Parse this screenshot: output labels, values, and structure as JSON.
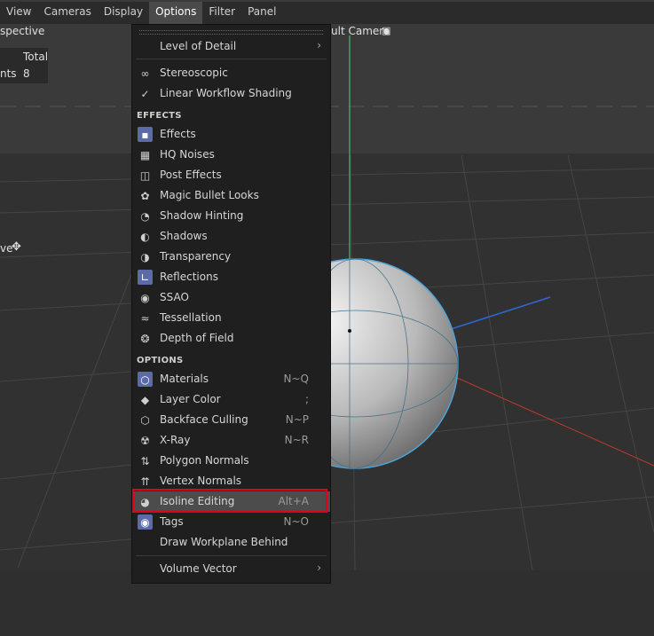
{
  "menubar": {
    "items": [
      "View",
      "Cameras",
      "Display",
      "Options",
      "Filter",
      "Panel"
    ],
    "active": "Options"
  },
  "viewport": {
    "view_name": "spective",
    "camera_label": "ult Camera",
    "hud_header": "Total",
    "hud_row_label": "nts",
    "hud_row_value": "8",
    "move_label": "ve"
  },
  "menu": {
    "level_of_detail": "Level of Detail",
    "stereoscopic": "Stereoscopic",
    "linear_workflow": "Linear Workflow Shading",
    "section_effects": "EFFECTS",
    "effects": [
      {
        "label": "Effects",
        "icon": "effects-icon"
      },
      {
        "label": "HQ Noises",
        "icon": "noise-icon"
      },
      {
        "label": "Post Effects",
        "icon": "clapper-icon"
      },
      {
        "label": "Magic Bullet Looks",
        "icon": "bullet-icon"
      },
      {
        "label": "Shadow Hinting",
        "icon": "shadow-hint-icon"
      },
      {
        "label": "Shadows",
        "icon": "shadows-icon"
      },
      {
        "label": "Transparency",
        "icon": "transparency-icon"
      },
      {
        "label": "Reflections",
        "icon": "reflections-icon"
      },
      {
        "label": "SSAO",
        "icon": "ssao-icon"
      },
      {
        "label": "Tessellation",
        "icon": "tessellation-icon"
      },
      {
        "label": "Depth of Field",
        "icon": "aperture-icon"
      }
    ],
    "section_options": "OPTIONS",
    "options": [
      {
        "label": "Materials",
        "shortcut": "N~Q",
        "icon": "materials-icon"
      },
      {
        "label": "Layer Color",
        "shortcut": ";",
        "icon": "layers-icon"
      },
      {
        "label": "Backface Culling",
        "shortcut": "N~P",
        "icon": "cube-icon"
      },
      {
        "label": "X-Ray",
        "shortcut": "N~R",
        "icon": "xray-icon"
      },
      {
        "label": "Polygon Normals",
        "shortcut": "",
        "icon": "polygon-normals-icon"
      },
      {
        "label": "Vertex Normals",
        "shortcut": "",
        "icon": "vertex-normals-icon"
      },
      {
        "label": "Isoline Editing",
        "shortcut": "Alt+A",
        "icon": "isoline-icon"
      },
      {
        "label": "Tags",
        "shortcut": "N~O",
        "icon": "eye-icon"
      },
      {
        "label": "Draw Workplane Behind",
        "shortcut": "",
        "icon": ""
      }
    ],
    "volume_vector": "Volume Vector"
  }
}
